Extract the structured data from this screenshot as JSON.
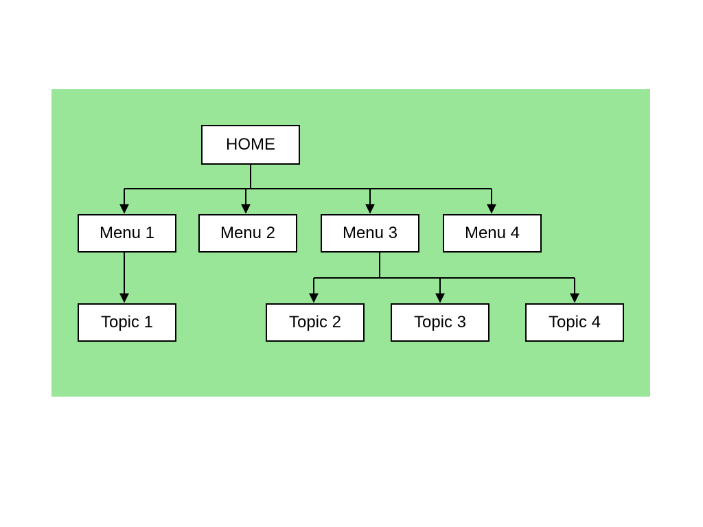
{
  "diagram": {
    "home": "HOME",
    "menus": [
      "Menu 1",
      "Menu 2",
      "Menu 3",
      "Menu 4"
    ],
    "topics": [
      "Topic 1",
      "Topic 2",
      "Topic 3",
      "Topic 4"
    ]
  }
}
